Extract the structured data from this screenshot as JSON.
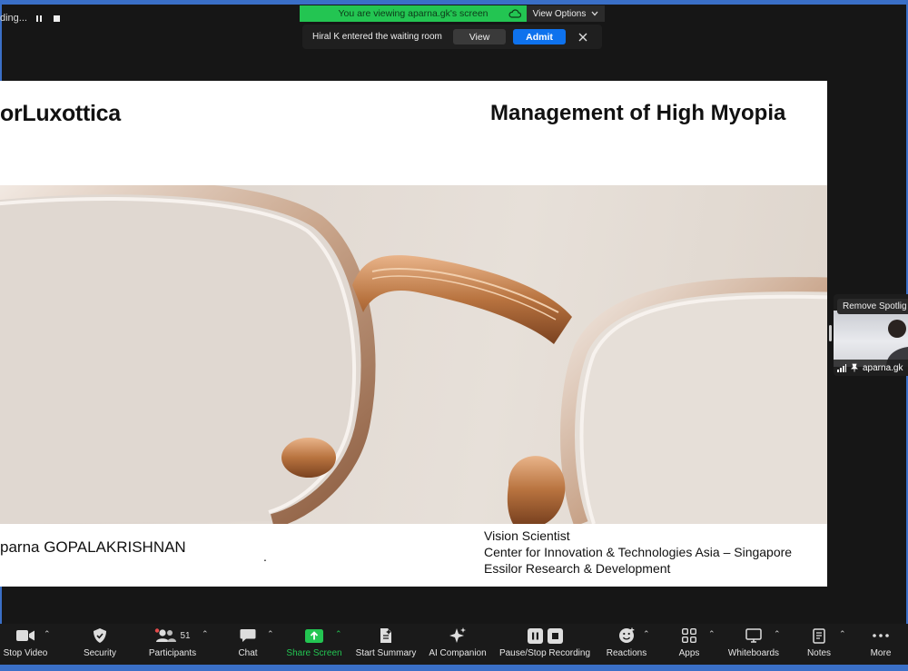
{
  "recording": {
    "label": "ding..."
  },
  "banner": {
    "viewing_text": "You are viewing aparna.gk's screen",
    "view_options": "View Options"
  },
  "waiting_room": {
    "message": "Hiral K entered the waiting room",
    "view_label": "View",
    "admit_label": "Admit"
  },
  "slide": {
    "brand": "orLuxottica",
    "title": "Management of High Myopia",
    "presenter": "parna GOPALAKRISHNAN",
    "dot": ".",
    "role_line1": "Vision Scientist",
    "role_line2": "Center for Innovation & Technologies Asia – Singapore",
    "role_line3": "Essilor Research & Development"
  },
  "self_view": {
    "remove_label": "Remove Spotlig",
    "name": "aparna.gk"
  },
  "toolbar": {
    "stop_video": "Stop Video",
    "security": "Security",
    "participants": "Participants",
    "participants_count": "51",
    "chat": "Chat",
    "share_screen": "Share Screen",
    "start_summary": "Start Summary",
    "ai_companion": "AI Companion",
    "pause_stop_recording": "Pause/Stop Recording",
    "reactions": "Reactions",
    "apps": "Apps",
    "whiteboards": "Whiteboards",
    "notes": "Notes",
    "more": "More"
  },
  "colors": {
    "accent_blue": "#0e72ed",
    "share_green": "#23c552",
    "frame_blue": "#3a6fc7"
  }
}
